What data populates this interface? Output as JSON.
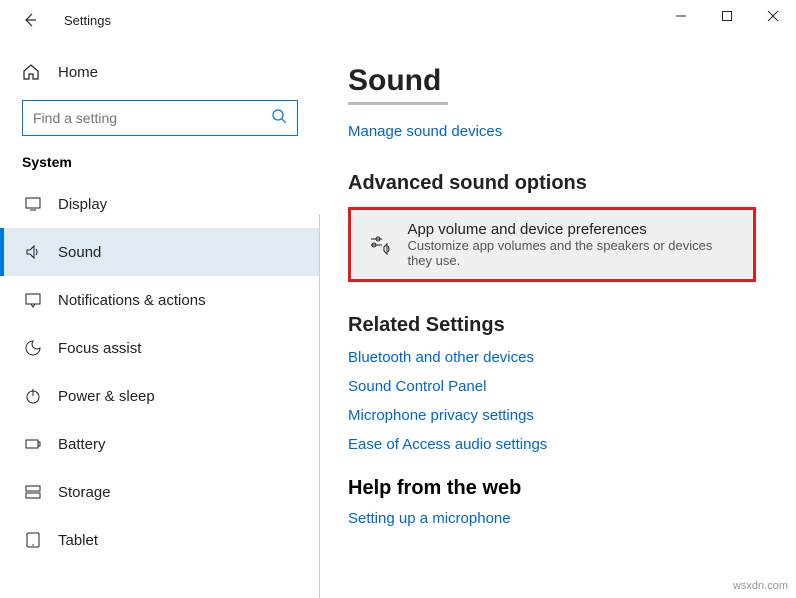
{
  "titlebar": {
    "title": "Settings"
  },
  "sidebar": {
    "home": "Home",
    "search_placeholder": "Find a setting",
    "system_header": "System",
    "items": [
      {
        "label": "Display"
      },
      {
        "label": "Sound"
      },
      {
        "label": "Notifications & actions"
      },
      {
        "label": "Focus assist"
      },
      {
        "label": "Power & sleep"
      },
      {
        "label": "Battery"
      },
      {
        "label": "Storage"
      },
      {
        "label": "Tablet"
      }
    ]
  },
  "content": {
    "page_title": "Sound",
    "manage_link": "Manage sound devices",
    "advanced_header": "Advanced sound options",
    "pref_title": "App volume and device preferences",
    "pref_sub": "Customize app volumes and the speakers or devices they use.",
    "related_header": "Related Settings",
    "related_links": [
      "Bluetooth and other devices",
      "Sound Control Panel",
      "Microphone privacy settings",
      "Ease of Access audio settings"
    ],
    "help_header": "Help from the web",
    "help_link": "Setting up a microphone"
  },
  "watermark": "wsxdn.com"
}
